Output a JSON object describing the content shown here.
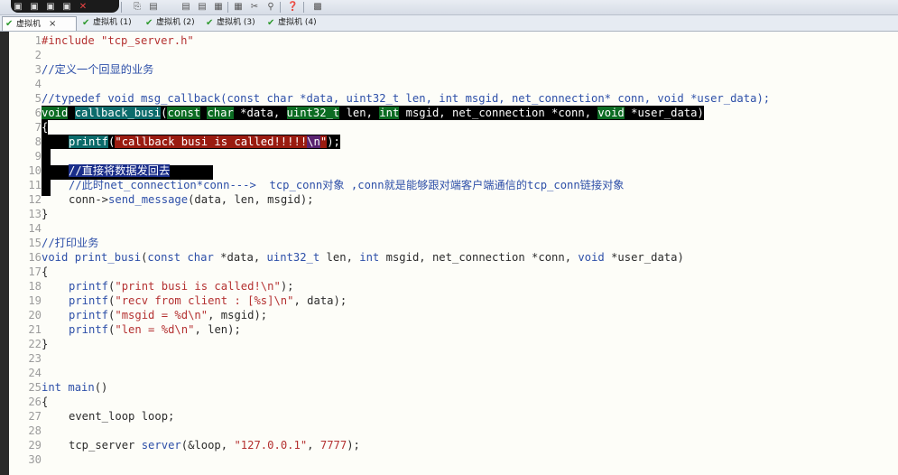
{
  "tabs": [
    {
      "label": "虚拟机",
      "active": true,
      "close": "×"
    },
    {
      "label": "虚拟机 (1)",
      "active": false
    },
    {
      "label": "虚拟机 (2)",
      "active": false
    },
    {
      "label": "虚拟机 (3)",
      "active": false
    },
    {
      "label": "虚拟机 (4)",
      "active": false
    }
  ],
  "toolbar_icons": [
    "window-icon",
    "window-icon",
    "window-icon",
    "close-icon",
    "copy-icon",
    "print-icon",
    "print-icon",
    "save-icon",
    "settings-icon",
    "tools-icon",
    "pin-icon",
    "help-icon",
    "snapshot-icon"
  ],
  "line_numbers": [
    "1",
    "2",
    "3",
    "4",
    "5",
    "6",
    "7",
    "8",
    "9",
    "10",
    "11",
    "12",
    "13",
    "14",
    "15",
    "16",
    "17",
    "18",
    "19",
    "20",
    "21",
    "22",
    "23",
    "24",
    "25",
    "26",
    "27",
    "28",
    "29",
    "30"
  ],
  "code": {
    "l1": "#include \"tcp_server.h\"",
    "l3": "//定义一个回显的业务",
    "l5": "//typedef void msg_callback(const char *data, uint32_t len, int msgid, net_connection* conn, void *user_data);",
    "l6": {
      "kw_void": "void",
      "fn": "callback_busi",
      "p1": "(",
      "kw_const": "const",
      "kw_char": "char",
      "p2": " *data, ",
      "kw_u32": "uint32_t",
      "p3": " len, ",
      "kw_int": "int",
      "p4": " msgid, net_connection *conn, ",
      "kw_void2": "void",
      "p5": " *user_data)"
    },
    "l7": "{",
    "l8": {
      "fn": "printf",
      "p1": "(",
      "str": "\"callback busi is called!!!!!",
      "esc": "\\n",
      "str2": "\"",
      "p2": ");"
    },
    "l10": "//直接将数据发回去",
    "l11": "//此时net_connection*conn--->  tcp_conn对象 ,conn就是能够跟对端客户端通信的tcp_conn链接对象",
    "l12": {
      "a": "conn->",
      "fn": "send_message",
      "b": "(data, len, msgid);"
    },
    "l13": "}",
    "l15": "//打印业务",
    "l16": {
      "kw": "void",
      "fn": "print_busi",
      "a": "(",
      "kw2": "const",
      "kw3": "char",
      "b": " *data, ",
      "kw4": "uint32_t",
      "c": " len, ",
      "kw5": "int",
      "d": " msgid, net_connection *conn, ",
      "kw6": "void",
      "e": " *user_data)"
    },
    "l17": "{",
    "l18": {
      "fn": "printf",
      "a": "(",
      "s": "\"print busi is called!\\n\"",
      "b": ");"
    },
    "l19": {
      "fn": "printf",
      "a": "(",
      "s": "\"recv from client : [%s]\\n\"",
      "b": ", data);"
    },
    "l20": {
      "fn": "printf",
      "a": "(",
      "s": "\"msgid = %d\\n\"",
      "b": ", msgid);"
    },
    "l21": {
      "fn": "printf",
      "a": "(",
      "s": "\"len = %d\\n\"",
      "b": ", len);"
    },
    "l22": "}",
    "l25": {
      "kw": "int",
      "fn": "main",
      "a": "()"
    },
    "l26": "{",
    "l27": "event_loop loop;",
    "l29": {
      "a": "tcp_server ",
      "fn": "server",
      "b": "(&loop, ",
      "s": "\"127.0.0.1\"",
      "c": ", ",
      "n": "7777",
      "d": ");"
    }
  }
}
